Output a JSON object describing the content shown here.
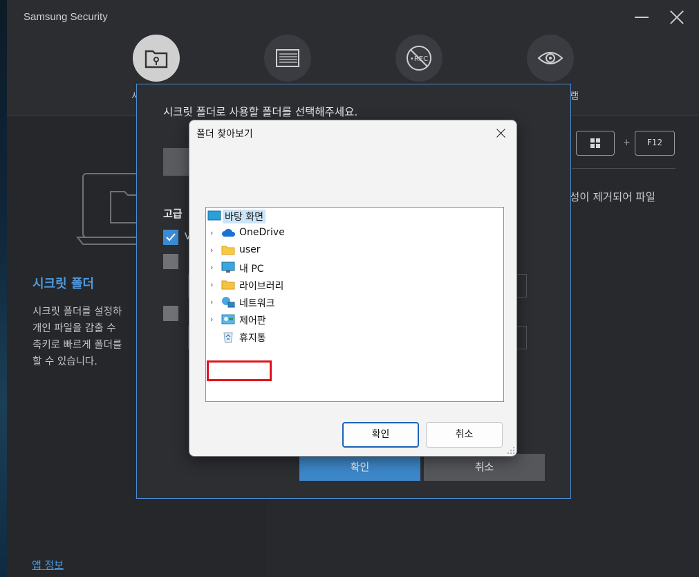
{
  "app": {
    "title": "Samsung Security",
    "nav_peek_left": "시",
    "nav_peek_right": "램",
    "nav": [
      {
        "name": "secret-folder",
        "icon": "folder-lock-icon",
        "active": true
      },
      {
        "name": "screen-capture",
        "icon": "screen-capture-icon",
        "active": false
      },
      {
        "name": "rec-block",
        "icon": "rec-block-icon",
        "active": false
      },
      {
        "name": "privacy",
        "icon": "eye-icon",
        "active": false
      }
    ]
  },
  "left_panel": {
    "feature_title": "시크릿 폴더",
    "feature_desc": "시크릿 폴더를 설정하\n개인 파일을 감출 수\n축키로 빠르게 폴더를\n할 수 있습니다.",
    "app_info_link": "앱 정보"
  },
  "right_panel": {
    "shortcut_key_win_icon": "windows-icon",
    "shortcut_plus": "+",
    "shortcut_key": "F12",
    "desc_peek": "성이 제거되어 파일"
  },
  "secret_dialog": {
    "prompt": "시크릿 폴더로 사용할 폴더를 선택해주세요.",
    "advanced_label": "고급",
    "check_1_peek": "V",
    "check_1_checked": true,
    "check_2_checked": false,
    "check_3_checked": false,
    "ok_label": "확인",
    "cancel_label": "취소"
  },
  "folder_browser": {
    "title": "폴더 찾아보기",
    "root": {
      "label": "바탕 화면",
      "icon": "desktop-icon"
    },
    "items": [
      {
        "label": "OneDrive",
        "icon": "cloud-icon",
        "expandable": true
      },
      {
        "label": "user",
        "icon": "folder-icon",
        "expandable": true
      },
      {
        "label": "내 PC",
        "icon": "monitor-icon",
        "expandable": true
      },
      {
        "label": "라이브러리",
        "icon": "library-folder-icon",
        "expandable": true
      },
      {
        "label": "네트워크",
        "icon": "network-icon",
        "expandable": true
      },
      {
        "label": "제어판",
        "icon": "control-panel-icon",
        "expandable": true
      },
      {
        "label": "휴지통",
        "icon": "recycle-bin-icon",
        "expandable": false
      }
    ],
    "highlighted_item": "user",
    "ok_label": "확인",
    "cancel_label": "취소"
  },
  "colors": {
    "accent_blue": "#3d87c9",
    "highlight_red": "#e0121b",
    "selection_bg": "#cce4f7"
  }
}
